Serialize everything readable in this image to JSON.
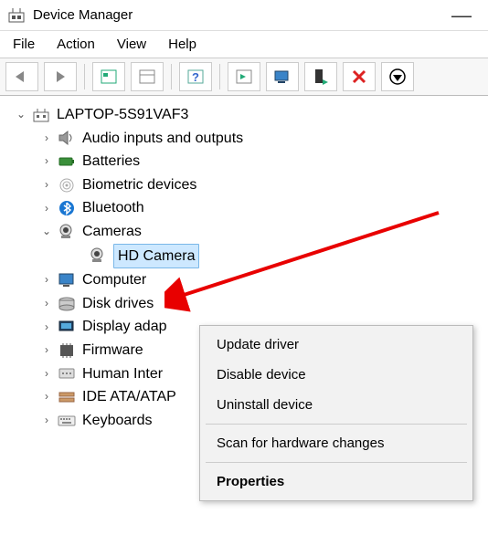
{
  "window": {
    "title": "Device Manager"
  },
  "menubar": [
    "File",
    "Action",
    "View",
    "Help"
  ],
  "toolbar_icons": [
    "back",
    "forward",
    "show-hidden",
    "properties-pane",
    "help",
    "refresh",
    "remote",
    "scan",
    "remove",
    "down"
  ],
  "tree": {
    "root": {
      "label": "LAPTOP-5S91VAF3",
      "expanded": true
    },
    "items": [
      {
        "label": "Audio inputs and outputs",
        "expanded": false,
        "icon": "speaker"
      },
      {
        "label": "Batteries",
        "expanded": false,
        "icon": "battery"
      },
      {
        "label": "Biometric devices",
        "expanded": false,
        "icon": "fingerprint"
      },
      {
        "label": "Bluetooth",
        "expanded": false,
        "icon": "bluetooth"
      },
      {
        "label": "Cameras",
        "expanded": true,
        "icon": "camera",
        "children": [
          {
            "label": "HD Camera",
            "icon": "camera",
            "selected": true
          }
        ]
      },
      {
        "label": "Computer",
        "expanded": false,
        "icon": "monitor"
      },
      {
        "label": "Disk drives",
        "expanded": false,
        "icon": "disk"
      },
      {
        "label": "Display adap",
        "expanded": false,
        "icon": "display"
      },
      {
        "label": "Firmware",
        "expanded": false,
        "icon": "chip"
      },
      {
        "label": "Human Inter",
        "expanded": false,
        "icon": "hid"
      },
      {
        "label": "IDE ATA/ATAP",
        "expanded": false,
        "icon": "ide"
      },
      {
        "label": "Keyboards",
        "expanded": false,
        "icon": "keyboard"
      }
    ]
  },
  "context_menu": {
    "items": [
      {
        "label": "Update driver"
      },
      {
        "label": "Disable device"
      },
      {
        "label": "Uninstall device"
      }
    ],
    "scan": "Scan for hardware changes",
    "properties": "Properties"
  }
}
